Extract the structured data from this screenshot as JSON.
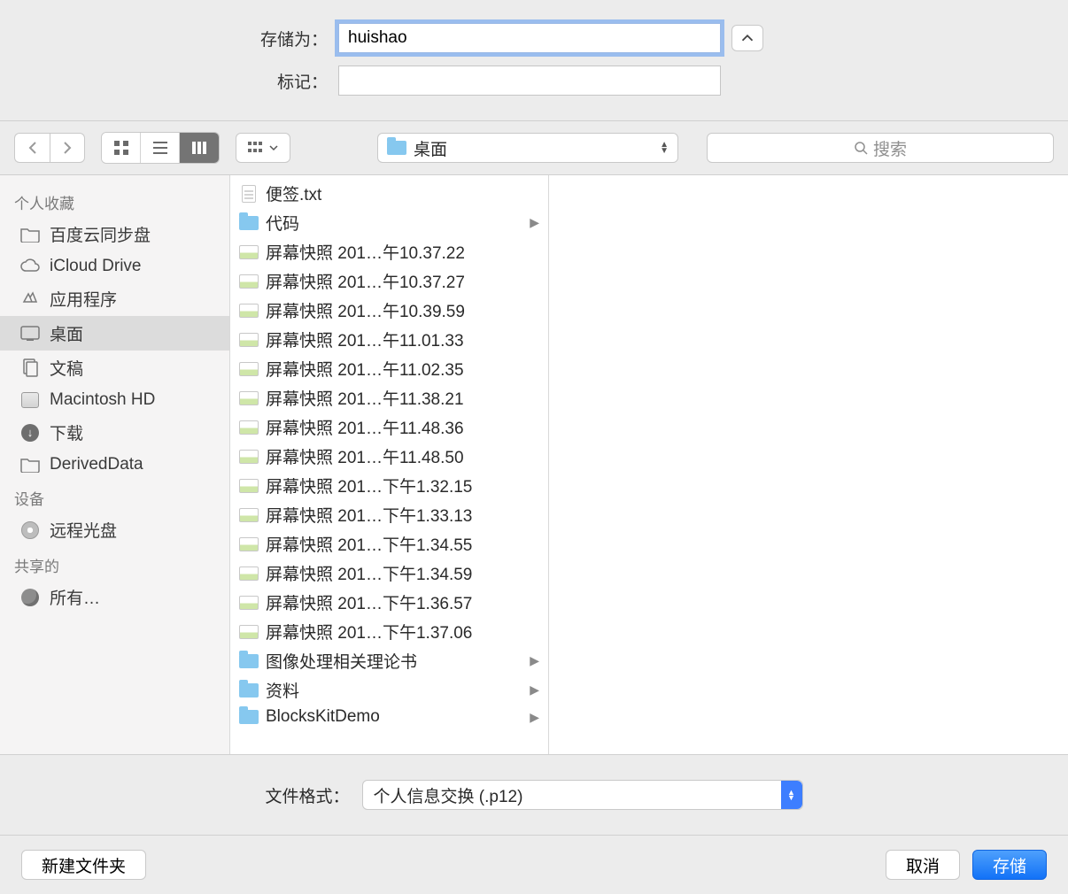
{
  "top": {
    "save_as_label": "存储为：",
    "save_as_value": "huishao",
    "tags_label": "标记：",
    "tags_value": ""
  },
  "toolbar": {
    "location": "桌面",
    "search_placeholder": "搜索"
  },
  "sidebar": {
    "sections": [
      {
        "header": "个人收藏",
        "items": [
          {
            "icon": "folder",
            "label": "百度云同步盘"
          },
          {
            "icon": "cloud",
            "label": "iCloud Drive"
          },
          {
            "icon": "apps",
            "label": "应用程序"
          },
          {
            "icon": "desktop",
            "label": "桌面",
            "selected": true
          },
          {
            "icon": "docs",
            "label": "文稿"
          },
          {
            "icon": "drive",
            "label": "Macintosh HD"
          },
          {
            "icon": "download",
            "label": "下载"
          },
          {
            "icon": "folder",
            "label": "DerivedData"
          }
        ]
      },
      {
        "header": "设备",
        "items": [
          {
            "icon": "disc",
            "label": "远程光盘"
          }
        ]
      },
      {
        "header": "共享的",
        "items": [
          {
            "icon": "globe",
            "label": "所有…"
          }
        ]
      }
    ]
  },
  "column": {
    "rows": [
      {
        "type": "doc",
        "name": "便签.txt"
      },
      {
        "type": "folder",
        "name": "代码",
        "children": true
      },
      {
        "type": "image",
        "name": "屏幕快照 201…午10.37.22"
      },
      {
        "type": "image",
        "name": "屏幕快照 201…午10.37.27"
      },
      {
        "type": "image",
        "name": "屏幕快照 201…午10.39.59"
      },
      {
        "type": "image",
        "name": "屏幕快照 201…午11.01.33"
      },
      {
        "type": "image",
        "name": "屏幕快照 201…午11.02.35"
      },
      {
        "type": "image",
        "name": "屏幕快照 201…午11.38.21"
      },
      {
        "type": "image",
        "name": "屏幕快照 201…午11.48.36"
      },
      {
        "type": "image",
        "name": "屏幕快照 201…午11.48.50"
      },
      {
        "type": "image",
        "name": "屏幕快照 201…下午1.32.15"
      },
      {
        "type": "image",
        "name": "屏幕快照 201…下午1.33.13"
      },
      {
        "type": "image",
        "name": "屏幕快照 201…下午1.34.55"
      },
      {
        "type": "image",
        "name": "屏幕快照 201…下午1.34.59"
      },
      {
        "type": "image",
        "name": "屏幕快照 201…下午1.36.57"
      },
      {
        "type": "image",
        "name": "屏幕快照 201…下午1.37.06"
      },
      {
        "type": "folder",
        "name": "图像处理相关理论书",
        "children": true
      },
      {
        "type": "folder",
        "name": "资料",
        "children": true
      },
      {
        "type": "folder",
        "name": "BlocksKitDemo",
        "children": true
      }
    ]
  },
  "format": {
    "label": "文件格式：",
    "value": "个人信息交换 (.p12)"
  },
  "footer": {
    "new_folder": "新建文件夹",
    "cancel": "取消",
    "save": "存储"
  }
}
